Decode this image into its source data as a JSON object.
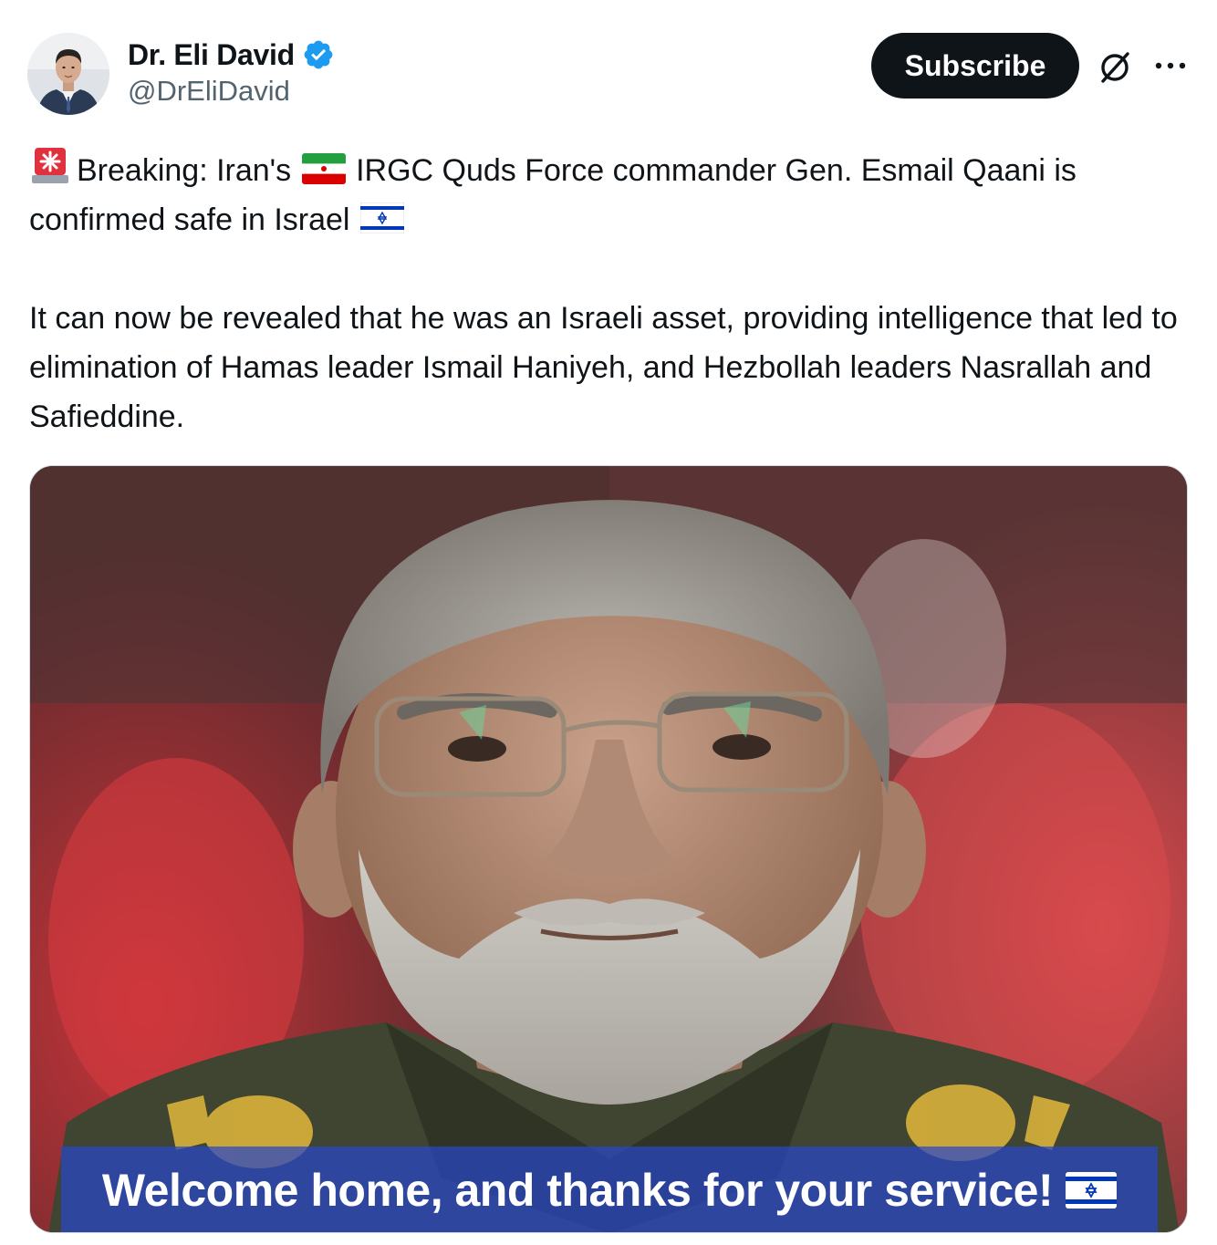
{
  "author": {
    "display_name": "Dr. Eli David",
    "handle": "@DrEliDavid",
    "verified": true
  },
  "header": {
    "subscribe_label": "Subscribe"
  },
  "icons": {
    "verified": "verified-badge-icon",
    "grok": "grok-icon",
    "more": "more-options-icon",
    "siren": "rotating-light-emoji",
    "iran_flag": "iran-flag-emoji",
    "israel_flag": "israel-flag-emoji"
  },
  "tweet": {
    "line1_part1": "Breaking: Iran's",
    "line1_part2": "IRGC Quds Force commander Gen. Esmail Qaani is confirmed safe in Israel",
    "paragraph2": "It can now be revealed that he was an Israeli asset, providing intelligence that led to elimination of Hamas leader Ismail Haniyeh, and Hezbollah leaders Nasrallah and Safieddine."
  },
  "media": {
    "caption": "Welcome home, and thanks for your service!"
  },
  "colors": {
    "text_primary": "#0f1419",
    "text_secondary": "#536471",
    "verified_blue": "#1d9bf0",
    "subscribe_bg": "#0f1419",
    "caption_bar": "#2846c8"
  }
}
